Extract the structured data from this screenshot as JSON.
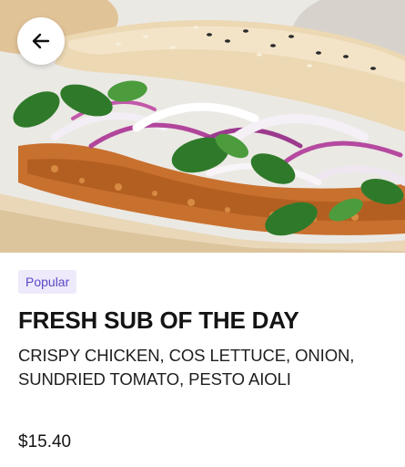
{
  "header": {
    "back_icon": "arrow-left-icon"
  },
  "item": {
    "badge": "Popular",
    "title": "FRESH SUB OF THE DAY",
    "description": "CRISPY CHICKEN, COS LETTUCE, ONION, SUNDRIED TOMATO, PESTO AIOLI",
    "price": "$15.40"
  },
  "colors": {
    "badge_bg": "#eeeafb",
    "badge_text": "#5a49c7",
    "text_primary": "#141414"
  }
}
